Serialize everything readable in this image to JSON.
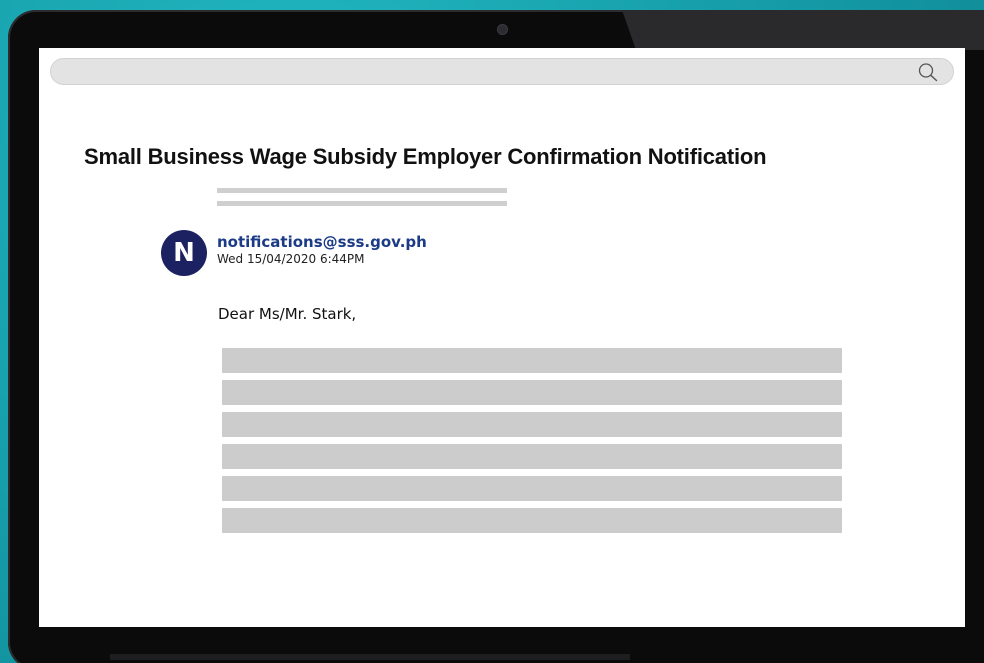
{
  "email": {
    "title": "Small Business Wage Subsidy Employer Confirmation Notification",
    "avatar_letter": "N",
    "sender": "notifications@sss.gov.ph",
    "timestamp": "Wed 15/04/2020 6:44PM",
    "greeting": "Dear Ms/Mr. Stark,",
    "placeholder_subject_lines": 2,
    "placeholder_body_lines": 6
  },
  "search": {
    "icon": "search-icon"
  },
  "colors": {
    "background": "#1aa7b3",
    "avatar": "#1c2161",
    "sender": "#1c3b86",
    "placeholder": "#cccccc"
  }
}
